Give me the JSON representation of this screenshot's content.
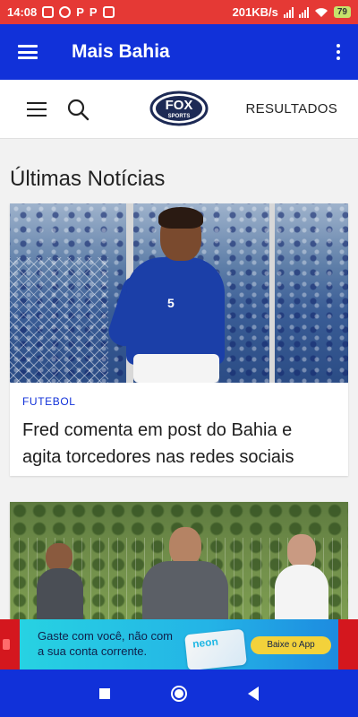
{
  "status_bar": {
    "time": "14:08",
    "icons_left": [
      "photo-icon",
      "whatsapp-icon",
      "p-app-icon",
      "p-app-icon",
      "calendar-icon"
    ],
    "p_glyph": "P",
    "net_speed": "201KB/s",
    "battery": "79"
  },
  "app_bar": {
    "title": "Mais Bahia"
  },
  "fox_header": {
    "logo_text": "FOX",
    "logo_sub": "SPORTS",
    "results_label": "RESULTADOS"
  },
  "section": {
    "title": "Últimas Notícias"
  },
  "articles": [
    {
      "category": "FUTEBOL",
      "headline": "Fred comenta em post do Bahia e agita torcedores nas redes sociais",
      "jersey_number": "5"
    },
    {
      "category": "",
      "headline": ""
    }
  ],
  "ad": {
    "text_line1": "Gaste com você, não com",
    "text_line2": "a sua conta corrente.",
    "brand": "neon",
    "cta": "Baixe o App"
  },
  "colors": {
    "status_bar": "#e53935",
    "app_bar": "#1131d9",
    "accent": "#1131d9",
    "nav_bar": "#1131d9"
  }
}
